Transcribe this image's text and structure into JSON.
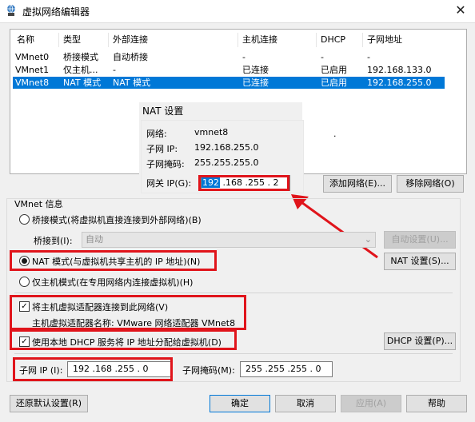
{
  "window": {
    "title": "虚拟网络编辑器",
    "close_glyph": "✕"
  },
  "table": {
    "headers": [
      "名称",
      "类型",
      "外部连接",
      "主机连接",
      "DHCP",
      "子网地址"
    ],
    "rows": [
      [
        "VMnet0",
        "桥接模式",
        "自动桥接",
        "-",
        "-",
        "-"
      ],
      [
        "VMnet1",
        "仅主机...",
        "-",
        "已连接",
        "已启用",
        "192.168.133.0"
      ],
      [
        "VMnet8",
        "NAT 模式",
        "NAT 模式",
        "已连接",
        "已启用",
        "192.168.255.0"
      ]
    ],
    "selected_row": 2
  },
  "nat_popup": {
    "title": "NAT 设置",
    "network_label": "网络:",
    "network_value": "vmnet8",
    "subnet_ip_label": "子网 IP:",
    "subnet_ip_value": "192.168.255.0",
    "subnet_mask_label": "子网掩码:",
    "subnet_mask_value": "255.255.255.0",
    "gateway_label": "网关 IP(G):",
    "gateway_sel": "192",
    "gateway_rest": " .168 .255 . 2",
    "dot": "."
  },
  "buttons": {
    "add_network": "添加网络(E)...",
    "remove_network": "移除网络(O)",
    "auto_settings": "自动设置(U)...",
    "nat_settings": "NAT 设置(S)...",
    "dhcp_settings": "DHCP 设置(P)...",
    "restore_defaults": "还原默认设置(R)",
    "ok": "确定",
    "cancel": "取消",
    "apply": "应用(A)",
    "help": "帮助"
  },
  "vmnet_info": {
    "title": "VMnet 信息",
    "bridge_mode": "桥接模式(将虚拟机直接连接到外部网络)(B)",
    "bridge_to_label": "桥接到(I):",
    "bridge_to_value": "自动",
    "nat_mode": "NAT 模式(与虚拟机共享主机的 IP 地址)(N)",
    "host_only_mode": "仅主机模式(在专用网络内连接虚拟机)(H)",
    "connect_adapter": "将主机虚拟适配器连接到此网络(V)",
    "adapter_name": "主机虚拟适配器名称: VMware 网络适配器 VMnet8",
    "use_dhcp": "使用本地 DHCP 服务将 IP 地址分配给虚拟机(D)",
    "subnet_ip_label": "子网 IP (I):",
    "subnet_ip_value": "192 .168 .255 . 0",
    "subnet_mask_label": "子网掩码(M):",
    "subnet_mask_value": "255 .255 .255 . 0",
    "check_glyph": "✓",
    "combo_arrow": "⌄",
    "selected_mode": "nat"
  },
  "colors": {
    "selection": "#0078d7",
    "annotation_red": "#e0141b"
  }
}
